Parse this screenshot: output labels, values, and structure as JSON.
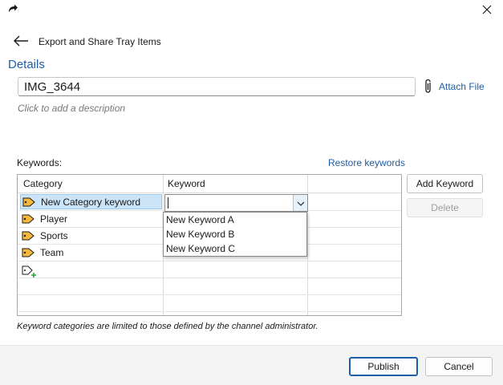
{
  "header": {
    "title": "Export and Share Tray Items"
  },
  "details": {
    "heading": "Details",
    "name_value": "IMG_3644",
    "attach_label": "Attach File",
    "description_placeholder": "Click to add a description"
  },
  "keywords": {
    "label": "Keywords:",
    "restore_label": "Restore keywords",
    "columns": [
      "Category",
      "Keyword"
    ],
    "rows": [
      {
        "category": "New Category keyword",
        "selected": true
      },
      {
        "category": "Player"
      },
      {
        "category": "Sports"
      },
      {
        "category": "Team"
      }
    ],
    "keyword_input_value": "",
    "dropdown_options": [
      "New Keyword A",
      "New Keyword B",
      "New Keyword C"
    ],
    "add_label": "Add Keyword",
    "delete_label": "Delete",
    "footnote": "Keyword categories are limited to those defined by the channel administrator."
  },
  "footer": {
    "publish_label": "Publish",
    "cancel_label": "Cancel"
  },
  "colors": {
    "accent": "#1f5ea8",
    "selection": "#cce4f7",
    "tag": "#f5b83d"
  },
  "icons": [
    "app-share-icon",
    "close-icon",
    "back-arrow-icon",
    "paperclip-icon",
    "tag-icon",
    "chevron-down-icon",
    "add-category-icon"
  ]
}
